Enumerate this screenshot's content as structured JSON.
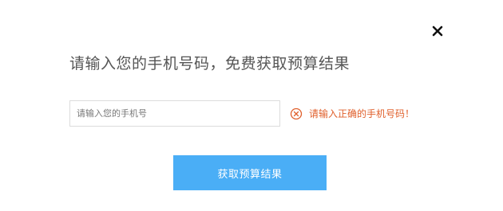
{
  "dialog": {
    "title": "请输入您的手机号码，免费获取预算结果",
    "close_icon": "close-icon"
  },
  "phone_field": {
    "placeholder": "请输入您的手机号",
    "value": ""
  },
  "error": {
    "icon": "error-circle-x-icon",
    "message": "请输入正确的手机号码！",
    "color": "#e0602c"
  },
  "submit": {
    "label": "获取预算结果",
    "color": "#4aaef6"
  }
}
